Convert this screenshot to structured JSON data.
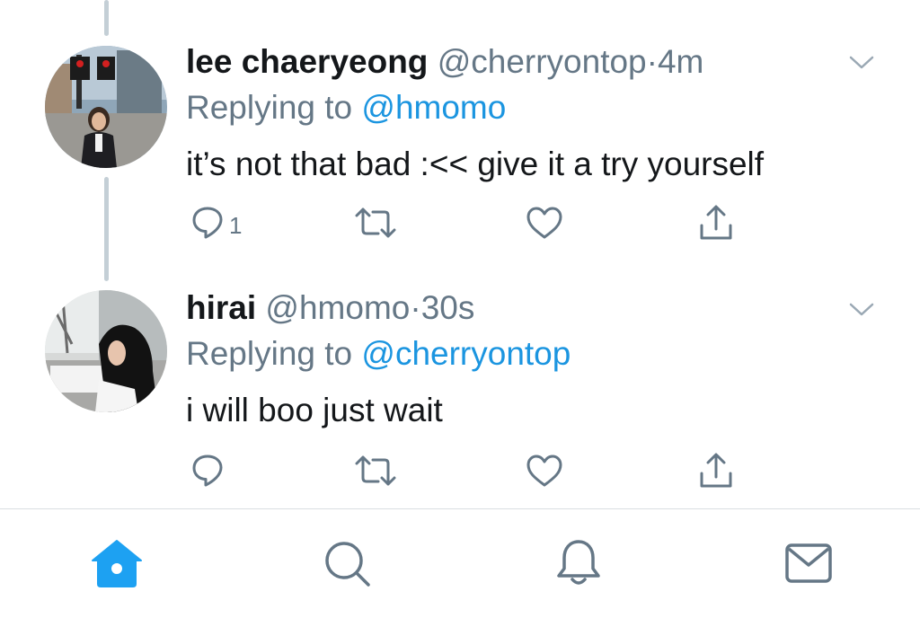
{
  "colors": {
    "accent": "#1da1f2",
    "mention": "#1b95e0",
    "secondary_text": "#657786",
    "primary_text": "#14171a",
    "thread_line": "#c4cfd6"
  },
  "tweets": [
    {
      "display_name": "lee chaeryeong",
      "handle": "@cherryontop",
      "separator": "·",
      "time": "4m",
      "replying_prefix": "Replying to ",
      "replying_to": "@hmomo",
      "text": "it’s not that bad :<< give it a try yourself",
      "reply_count": "1",
      "icons": [
        "reply-icon",
        "retweet-icon",
        "like-icon",
        "share-icon",
        "chevron-down-icon"
      ]
    },
    {
      "display_name": "hirai",
      "handle": "@hmomo",
      "separator": "·",
      "time": "30s",
      "replying_prefix": "Replying to ",
      "replying_to": "@cherryontop",
      "text": "i will boo just wait",
      "reply_count": "",
      "icons": [
        "reply-icon",
        "retweet-icon",
        "like-icon",
        "share-icon",
        "chevron-down-icon"
      ]
    }
  ],
  "tabbar": {
    "active": "home",
    "items": [
      "home-icon",
      "search-icon",
      "notifications-icon",
      "messages-icon"
    ]
  }
}
